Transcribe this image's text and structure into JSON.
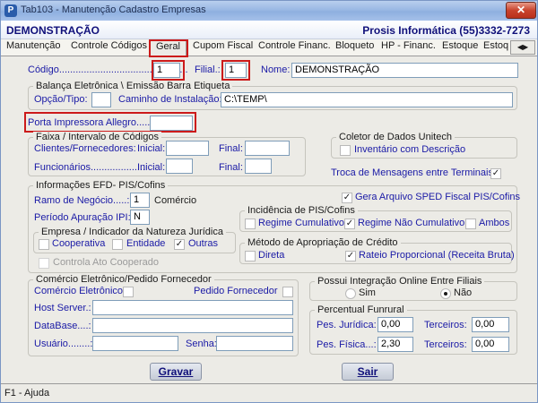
{
  "window": {
    "title": "Tab103 - Manutenção Cadastro Empresas",
    "app_icon": "P",
    "close_label": "✕"
  },
  "header": {
    "company": "DEMONSTRAÇÃO",
    "vendor": "Prosis Informática (55)3332-7273"
  },
  "tabs": [
    "Manutenção",
    "Controle Códigos",
    "Geral",
    "Cupom Fiscal",
    "Controle Financ.",
    "Bloqueto",
    "HP - Financ.",
    "Estoque",
    "Estoq"
  ],
  "top": {
    "codigo_label": "Código...............................................",
    "codigo_value": "1",
    "filial_label": "Filial.:",
    "filial_value": "1",
    "nome_label": "Nome:",
    "nome_value": "DEMONSTRAÇÃO"
  },
  "balanca": {
    "title": "Balança Eletrônica \\ Emissão Barra Etiqueta",
    "opcao_label": "Opção/Tipo:",
    "opcao_value": "",
    "caminho_label": "Caminho de Instalação:",
    "caminho_value": "C:\\TEMP\\"
  },
  "porta": {
    "label": "Porta Impressora Allegro.....:",
    "value": ""
  },
  "faixa": {
    "title": "Faixa / Intervalo de Códigos",
    "clientes_label": "Clientes/Fornecedores:",
    "funcionarios_label": "Funcionários...................:",
    "inicial_label": "Inicial:",
    "final_label": "Final:"
  },
  "coletor": {
    "title": "Coletor de Dados Unitech",
    "inventario_label": "Inventário com Descrição",
    "inventario_checked": ""
  },
  "troca": {
    "label": "Troca de Mensagens entre Terminais",
    "checked": "✓"
  },
  "efd": {
    "title": "Informações EFD- PIS/Cofins",
    "ramo_label": "Ramo de Negócio.....:",
    "ramo_value": "1",
    "ramo_desc": "Comércio",
    "apuracao_label": "Período Apuração IPI:",
    "apuracao_value": "N",
    "sped_label": "Gera Arquivo SPED Fiscal PIS/Cofins",
    "sped_checked": "✓"
  },
  "natureza": {
    "title": "Empresa / Indicador da Natureza Jurídica",
    "cooperativa": "Cooperativa",
    "entidade": "Entidade",
    "outras": "Outras",
    "outras_checked": "✓",
    "controla": "Controla Ato Cooperado"
  },
  "incidencia": {
    "title": "Incidência de PIS/Cofins",
    "cumulativo": "Regime Cumulativo",
    "nao_cumulativo": "Regime Não Cumulativo",
    "nao_cumulativo_checked": "✓",
    "ambos": "Ambos"
  },
  "metodo": {
    "title": "Método de Apropriação de Crédito",
    "direta": "Direta",
    "rateio": "Rateio Proporcional (Receita Bruta)",
    "rateio_checked": "✓"
  },
  "comercio": {
    "title": "Comércio Eletrônico/Pedido Fornecedor",
    "eletronico_label": "Comércio Eletrônico",
    "pedido_label": "Pedido Fornecedor",
    "host_label": "Host Server.:",
    "database_label": "DataBase....:",
    "usuario_label": "Usuário........:",
    "senha_label": "Senha:"
  },
  "integracao": {
    "title": "Possui Integração Online Entre Filiais",
    "sim": "Sim",
    "nao": "Não",
    "selected": "Não"
  },
  "funrural": {
    "title": "Percentual Funrural",
    "pj_label": "Pes. Jurídica:",
    "pj_value": "0,00",
    "pf_label": "Pes. Física...:",
    "pf_value": "2,30",
    "terceiros_label": "Terceiros:",
    "terceiros_pj": "0,00",
    "terceiros_pf": "0,00"
  },
  "buttons": {
    "gravar": "Gravar",
    "sair": "Sair"
  },
  "status": "F1 - Ajuda"
}
